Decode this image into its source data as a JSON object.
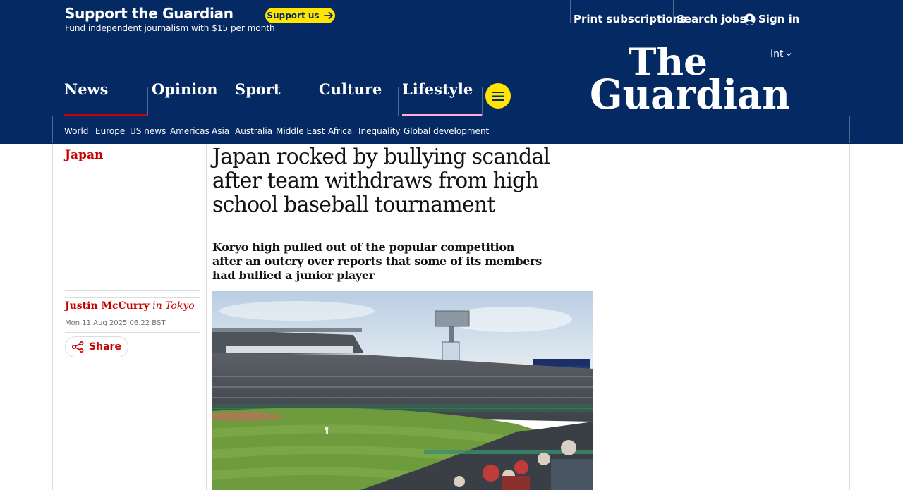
{
  "support_bar": {
    "title": "Support the Guardian",
    "subtitle": "Fund independent journalism with $15 per month",
    "button_label": "Support us",
    "links": {
      "print_subscriptions": "Print subscriptions",
      "search_jobs": "Search jobs",
      "sign_in": "Sign in"
    }
  },
  "masthead": {
    "edition": "Int",
    "logo_line1": "The",
    "logo_line2": "Guardian",
    "pillars": [
      {
        "label": "News",
        "accent": "#c70000"
      },
      {
        "label": "Opinion",
        "accent": "#ff7f0f"
      },
      {
        "label": "Sport",
        "accent": "#00b2ff"
      },
      {
        "label": "Culture",
        "accent": "#a1845c"
      },
      {
        "label": "Lifestyle",
        "accent": "#ffabdb"
      }
    ],
    "menu_icon": "hamburger-icon",
    "subnav": [
      "World",
      "Europe",
      "US news",
      "Americas",
      "Asia",
      "Australia",
      "Middle East",
      "Africa",
      "Inequality",
      "Global development"
    ]
  },
  "article": {
    "section": "Japan",
    "headline": "Japan rocked by bullying scandal after team withdraws from high school baseball tournament",
    "standfirst": "Koryo high pulled out of the popular competition after an outcry over reports that some of its members had bullied a junior player",
    "author": "Justin McCurry",
    "location": "in Tokyo",
    "date": "Mon 11 Aug 2025 06.22 BST",
    "share_label": "Share"
  },
  "colors": {
    "brand_blue": "#052962",
    "brand_yellow": "#ffe500",
    "news_red": "#c70000"
  }
}
